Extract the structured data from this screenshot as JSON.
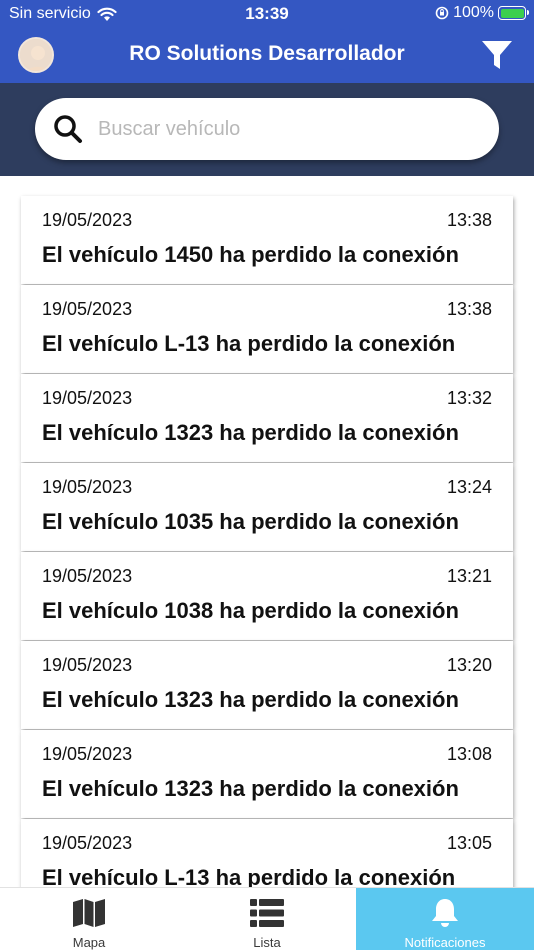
{
  "status_bar": {
    "carrier": "Sin servicio",
    "time": "13:39",
    "battery": "100%"
  },
  "header": {
    "title": "RO Solutions Desarrollador"
  },
  "search": {
    "placeholder": "Buscar vehículo"
  },
  "notifications": [
    {
      "date": "19/05/2023",
      "time": "13:38",
      "message": "El vehículo 1450 ha perdido la conexión"
    },
    {
      "date": "19/05/2023",
      "time": "13:38",
      "message": "El vehículo L-13 ha perdido la conexión"
    },
    {
      "date": "19/05/2023",
      "time": "13:32",
      "message": "El vehículo 1323 ha perdido la conexión"
    },
    {
      "date": "19/05/2023",
      "time": "13:24",
      "message": "El vehículo 1035 ha perdido la conexión"
    },
    {
      "date": "19/05/2023",
      "time": "13:21",
      "message": "El vehículo 1038 ha perdido la conexión"
    },
    {
      "date": "19/05/2023",
      "time": "13:20",
      "message": "El vehículo 1323 ha perdido la conexión"
    },
    {
      "date": "19/05/2023",
      "time": "13:08",
      "message": "El vehículo 1323 ha perdido la conexión"
    },
    {
      "date": "19/05/2023",
      "time": "13:05",
      "message": "El vehículo L-13 ha perdido la conexión"
    }
  ],
  "tabs": [
    {
      "label": "Mapa",
      "icon": "map-icon"
    },
    {
      "label": "Lista",
      "icon": "list-icon"
    },
    {
      "label": "Notificaciones",
      "icon": "bell-icon",
      "active": true
    }
  ],
  "colors": {
    "header_bg": "#3457c2",
    "search_bg": "#2e3d5e",
    "active_tab": "#5bc8f0"
  }
}
